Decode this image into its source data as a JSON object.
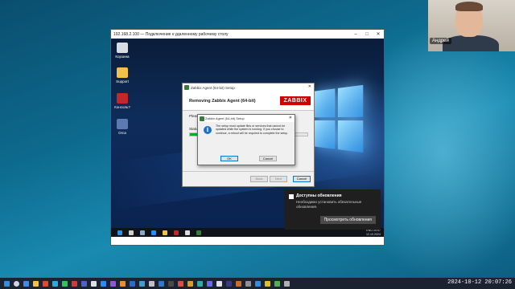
{
  "webcam": {
    "name": "Андрей"
  },
  "rdp": {
    "title": "192.168.2.100 — Подключение к удаленному рабочему столу",
    "buttons": {
      "minimize": "–",
      "maximize": "□",
      "close": "✕"
    }
  },
  "desktop_icons": [
    {
      "label": "Корзина"
    },
    {
      "label": "Support"
    },
    {
      "label": "Консоль?"
    },
    {
      "label": "Orca"
    }
  ],
  "setup": {
    "title": "Zabbix Agent (64-bit) Setup",
    "heading": "Removing Zabbix Agent (64-bit)",
    "logo": "ZABBIX",
    "please_wait": "Please w",
    "status_label": "Status:",
    "progress": 0.12,
    "buttons": {
      "back": "Back",
      "next": "Next",
      "cancel": "Cancel"
    }
  },
  "message": {
    "title": "Zabbix Agent (64-bit) Setup",
    "text": "The setup must update files or services that cannot be updated while the system is running. If you choose to continue, a reboot will be required to complete the setup.",
    "ok": "OK",
    "cancel": "Cancel"
  },
  "remote_tray": {
    "lang": "ENG",
    "time": "20:07",
    "date": "12.10.2024"
  },
  "notification": {
    "title": "Доступны обновления",
    "body": "Необходимо установить обязательные обновления.",
    "button": "Просмотреть обновления"
  },
  "host_clock": "2024-10-12 20:07:26",
  "colors": {
    "zabbix_red": "#d40000",
    "progress_green": "#06b025",
    "host_bg": "#0d6a8e"
  }
}
